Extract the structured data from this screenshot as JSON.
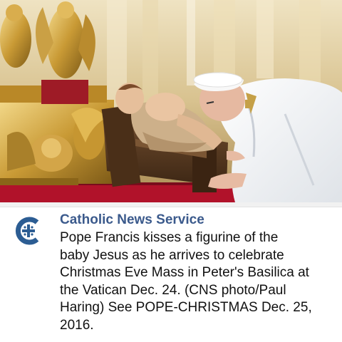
{
  "photo": {
    "alt_subject": "photo"
  },
  "post": {
    "source_name": "Catholic News Service",
    "caption_lines": [
      "Pope Francis kisses a figurine of the",
      "baby Jesus as he arrives to celebrate",
      "Christmas Eve Mass in Peter's Basilica at",
      "the Vatican Dec. 24. (CNS photo/Paul",
      "Haring) See POPE-CHRISTMAS Dec. 25,",
      "2016."
    ],
    "logo_icon": "cns-logo-icon"
  },
  "colors": {
    "source_name": "#3b5a8c",
    "logo_blue": "#2c5d93",
    "caption_text": "#111111"
  }
}
